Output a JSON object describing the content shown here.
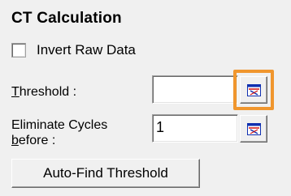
{
  "section": {
    "title": "CT Calculation"
  },
  "invert_raw_data": {
    "label": "Invert Raw Data",
    "checked": false
  },
  "threshold": {
    "label_mnemonic": "T",
    "label_rest": "hreshold :",
    "value": ""
  },
  "eliminate_cycles": {
    "label_line1": "Eliminate Cycles",
    "label_line2_mnemonic": "b",
    "label_line2_rest": "efore :",
    "value": "1"
  },
  "pick_button": {
    "icon": "chart-pick-icon"
  },
  "auto_find": {
    "label": "Auto-Find Threshold"
  },
  "colors": {
    "highlight": "#f0962e",
    "panel_background": "#f0f0f0",
    "icon_red": "#d01010",
    "icon_blue": "#1030b0"
  }
}
